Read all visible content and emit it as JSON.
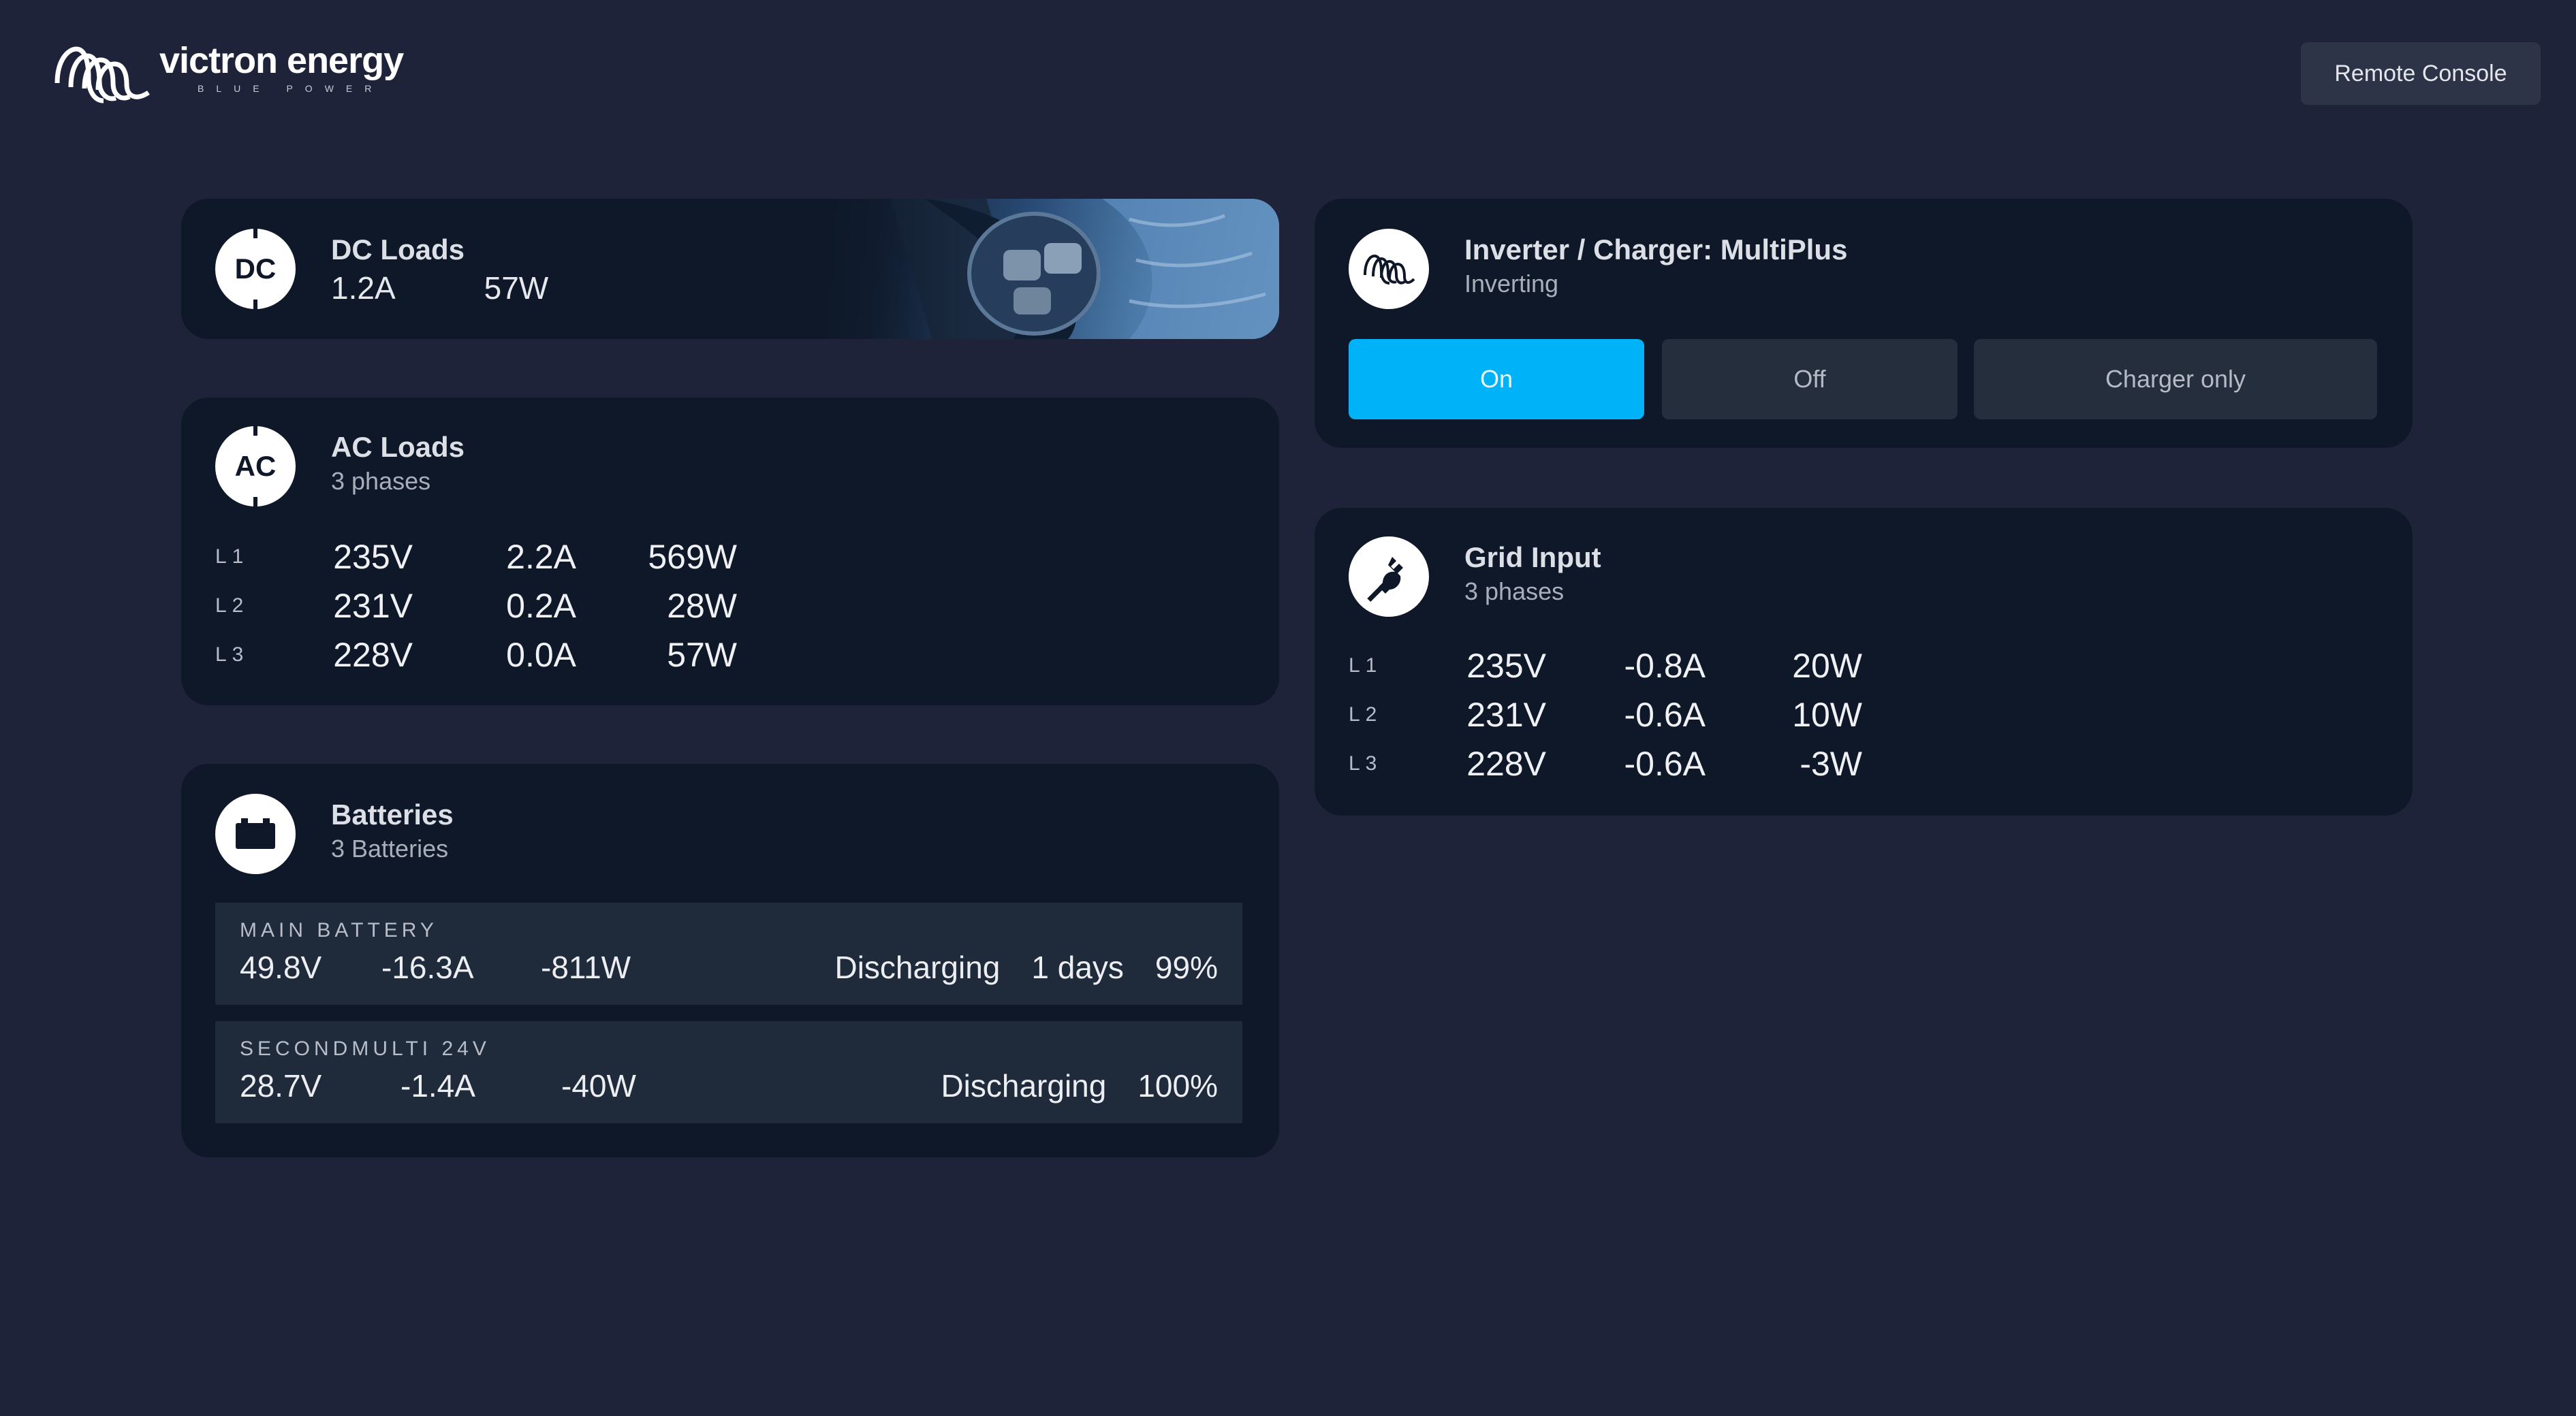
{
  "header": {
    "logo_name": "victron energy",
    "logo_tagline": "BLUE POWER",
    "remote_console_label": "Remote Console"
  },
  "dc_loads": {
    "badge": "DC",
    "title": "DC Loads",
    "current": "1.2A",
    "power": "57W"
  },
  "ac_loads": {
    "badge": "AC",
    "title": "AC Loads",
    "subtitle": "3 phases",
    "phases": [
      {
        "label": "L1",
        "voltage": "235V",
        "current": "2.2A",
        "power": "569W"
      },
      {
        "label": "L2",
        "voltage": "231V",
        "current": "0.2A",
        "power": "28W"
      },
      {
        "label": "L3",
        "voltage": "228V",
        "current": "0.0A",
        "power": "57W"
      }
    ]
  },
  "batteries": {
    "title": "Batteries",
    "subtitle": "3 Batteries",
    "items": [
      {
        "name": "MAIN BATTERY",
        "voltage": "49.8V",
        "current": "-16.3A",
        "power": "-811W",
        "state": "Discharging",
        "time": "1 days",
        "soc": "99%"
      },
      {
        "name": "SECONDMULTI 24V",
        "voltage": "28.7V",
        "current": "-1.4A",
        "power": "-40W",
        "state": "Discharging",
        "soc": "100%"
      }
    ]
  },
  "inverter": {
    "title": "Inverter / Charger: MultiPlus",
    "subtitle": "Inverting",
    "modes": [
      {
        "label": "On",
        "active": true
      },
      {
        "label": "Off",
        "active": false
      },
      {
        "label": "Charger only",
        "active": false
      }
    ]
  },
  "grid_input": {
    "title": "Grid Input",
    "subtitle": "3 phases",
    "phases": [
      {
        "label": "L1",
        "voltage": "235V",
        "current": "-0.8A",
        "power": "20W"
      },
      {
        "label": "L2",
        "voltage": "231V",
        "current": "-0.6A",
        "power": "10W"
      },
      {
        "label": "L3",
        "voltage": "228V",
        "current": "-0.6A",
        "power": "-3W"
      }
    ]
  },
  "colors": {
    "background": "#1e2339",
    "card": "#0e1828",
    "accent": "#00b2f7",
    "inactive_button": "#242e3d"
  },
  "icons": [
    "victron-logo-icon",
    "dc-badge-icon",
    "ac-badge-icon",
    "battery-icon",
    "inverter-coil-icon",
    "plug-icon",
    "boat-image"
  ]
}
